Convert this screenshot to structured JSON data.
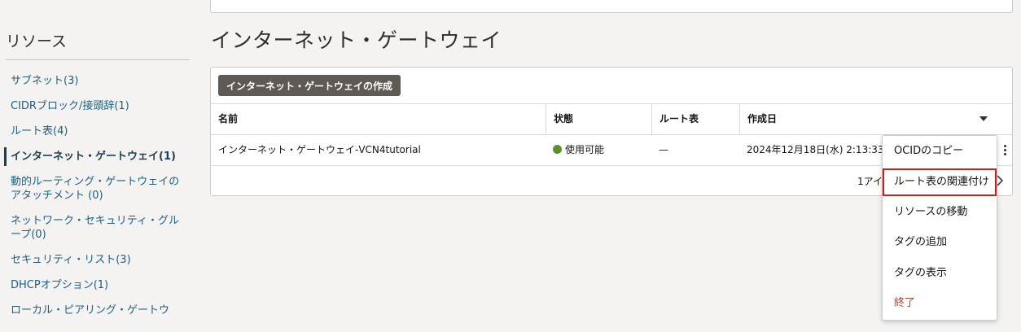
{
  "sidebar": {
    "title": "リソース",
    "items": [
      {
        "label": "サブネット(3)"
      },
      {
        "label": "CIDRブロック/接頭辞(1)"
      },
      {
        "label": "ルート表(4)"
      },
      {
        "label": "インターネット・ゲートウェイ(1)",
        "active": true
      },
      {
        "label": "動的ルーティング・ゲートウェイのアタッチメント (0)"
      },
      {
        "label": "ネットワーク・セキュリティ・グループ(0)"
      },
      {
        "label": "セキュリティ・リスト(3)"
      },
      {
        "label": "DHCPオプション(1)"
      },
      {
        "label": "ローカル・ピアリング・ゲートウ"
      }
    ]
  },
  "main": {
    "title": "インターネット・ゲートウェイ",
    "create_button": "インターネット・ゲートウェイの作成",
    "table": {
      "columns": [
        "名前",
        "状態",
        "ルート表",
        "作成日"
      ],
      "rows": [
        {
          "name": "インターネット・ゲートウェイ-VCN4tutorial",
          "status": "使用可能",
          "route_table": "—",
          "created": "2024年12月18日(水) 2:13:33 U"
        }
      ]
    },
    "pager_text": "1アイ"
  },
  "menu": {
    "items": [
      {
        "label": "OCIDのコピー"
      },
      {
        "label": "ルート表の関連付け",
        "highlighted": true
      },
      {
        "label": "リソースの移動"
      },
      {
        "label": "タグの追加"
      },
      {
        "label": "タグの表示"
      },
      {
        "label": "終了",
        "danger": true
      }
    ]
  },
  "colors": {
    "link": "#1b5f84",
    "status_available": "#5d8f2e",
    "primary_button": "#5f5954",
    "highlight_outline": "#d41b1b",
    "danger": "#b0412f"
  }
}
